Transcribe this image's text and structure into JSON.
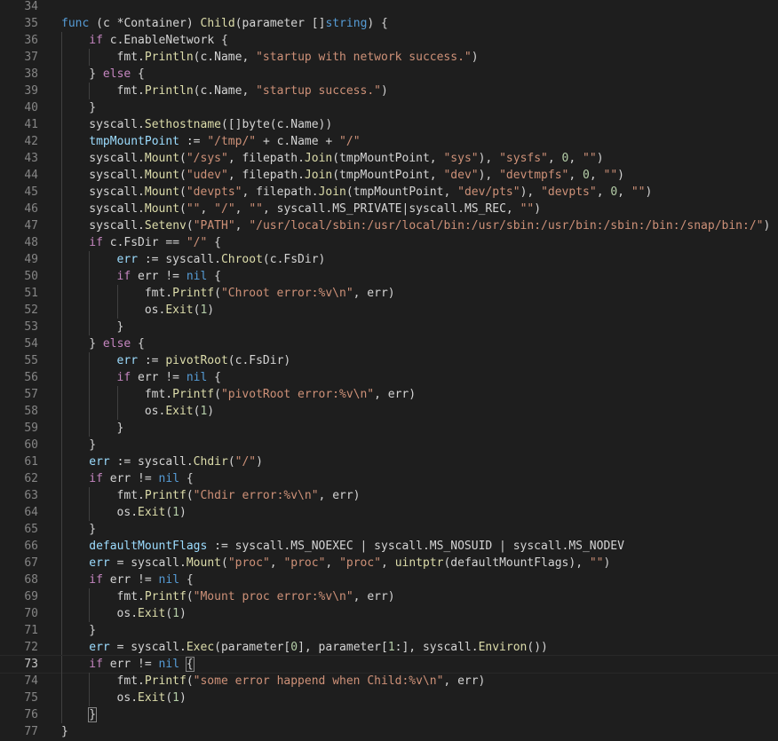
{
  "editor": {
    "colors": {
      "background": "#1e1e1e",
      "line_number": "#858585",
      "keyword": "#569cd6",
      "control": "#c586c0",
      "function": "#dcdcaa",
      "string": "#ce9178",
      "number": "#b5cea8",
      "variable": "#9cdcfe",
      "type": "#4ec9b0",
      "plain": "#d4d4d4"
    },
    "current_line": 73,
    "lines": [
      {
        "n": "34",
        "indent": 0,
        "tokens": []
      },
      {
        "n": "35",
        "indent": 0,
        "tokens": [
          [
            "kw",
            "func"
          ],
          [
            "p",
            " ("
          ],
          [
            "p",
            "c *Container"
          ],
          [
            "p",
            ") "
          ],
          [
            "fn",
            "Child"
          ],
          [
            "p",
            "(parameter []"
          ],
          [
            "kw",
            "string"
          ],
          [
            "p",
            ") {"
          ]
        ]
      },
      {
        "n": "36",
        "indent": 1,
        "tokens": [
          [
            "ctl",
            "if"
          ],
          [
            "p",
            " c.EnableNetwork {"
          ]
        ]
      },
      {
        "n": "37",
        "indent": 2,
        "tokens": [
          [
            "p",
            "fmt."
          ],
          [
            "fn",
            "Println"
          ],
          [
            "p",
            "(c.Name, "
          ],
          [
            "str",
            "\"startup with network success.\""
          ],
          [
            "p",
            ")"
          ]
        ]
      },
      {
        "n": "38",
        "indent": 1,
        "tokens": [
          [
            "p",
            "} "
          ],
          [
            "ctl",
            "else"
          ],
          [
            "p",
            " {"
          ]
        ]
      },
      {
        "n": "39",
        "indent": 2,
        "tokens": [
          [
            "p",
            "fmt."
          ],
          [
            "fn",
            "Println"
          ],
          [
            "p",
            "(c.Name, "
          ],
          [
            "str",
            "\"startup success.\""
          ],
          [
            "p",
            ")"
          ]
        ]
      },
      {
        "n": "40",
        "indent": 1,
        "tokens": [
          [
            "p",
            "}"
          ]
        ]
      },
      {
        "n": "41",
        "indent": 1,
        "tokens": [
          [
            "p",
            "syscall."
          ],
          [
            "fn",
            "Sethostname"
          ],
          [
            "p",
            "([]byte(c.Name))"
          ]
        ]
      },
      {
        "n": "42",
        "indent": 1,
        "tokens": [
          [
            "var",
            "tmpMountPoint"
          ],
          [
            "p",
            " := "
          ],
          [
            "str",
            "\"/tmp/\""
          ],
          [
            "p",
            " + c.Name + "
          ],
          [
            "str",
            "\"/\""
          ]
        ]
      },
      {
        "n": "43",
        "indent": 1,
        "tokens": [
          [
            "p",
            "syscall."
          ],
          [
            "fn",
            "Mount"
          ],
          [
            "p",
            "("
          ],
          [
            "str",
            "\"/sys\""
          ],
          [
            "p",
            ", filepath."
          ],
          [
            "fn",
            "Join"
          ],
          [
            "p",
            "(tmpMountPoint, "
          ],
          [
            "str",
            "\"sys\""
          ],
          [
            "p",
            "), "
          ],
          [
            "str",
            "\"sysfs\""
          ],
          [
            "p",
            ", "
          ],
          [
            "num",
            "0"
          ],
          [
            "p",
            ", "
          ],
          [
            "str",
            "\"\""
          ],
          [
            "p",
            ")"
          ]
        ]
      },
      {
        "n": "44",
        "indent": 1,
        "tokens": [
          [
            "p",
            "syscall."
          ],
          [
            "fn",
            "Mount"
          ],
          [
            "p",
            "("
          ],
          [
            "str",
            "\"udev\""
          ],
          [
            "p",
            ", filepath."
          ],
          [
            "fn",
            "Join"
          ],
          [
            "p",
            "(tmpMountPoint, "
          ],
          [
            "str",
            "\"dev\""
          ],
          [
            "p",
            "), "
          ],
          [
            "str",
            "\"devtmpfs\""
          ],
          [
            "p",
            ", "
          ],
          [
            "num",
            "0"
          ],
          [
            "p",
            ", "
          ],
          [
            "str",
            "\"\""
          ],
          [
            "p",
            ")"
          ]
        ]
      },
      {
        "n": "45",
        "indent": 1,
        "tokens": [
          [
            "p",
            "syscall."
          ],
          [
            "fn",
            "Mount"
          ],
          [
            "p",
            "("
          ],
          [
            "str",
            "\"devpts\""
          ],
          [
            "p",
            ", filepath."
          ],
          [
            "fn",
            "Join"
          ],
          [
            "p",
            "(tmpMountPoint, "
          ],
          [
            "str",
            "\"dev/pts\""
          ],
          [
            "p",
            "), "
          ],
          [
            "str",
            "\"devpts\""
          ],
          [
            "p",
            ", "
          ],
          [
            "num",
            "0"
          ],
          [
            "p",
            ", "
          ],
          [
            "str",
            "\"\""
          ],
          [
            "p",
            ")"
          ]
        ]
      },
      {
        "n": "46",
        "indent": 1,
        "tokens": [
          [
            "p",
            "syscall."
          ],
          [
            "fn",
            "Mount"
          ],
          [
            "p",
            "("
          ],
          [
            "str",
            "\"\""
          ],
          [
            "p",
            ", "
          ],
          [
            "str",
            "\"/\""
          ],
          [
            "p",
            ", "
          ],
          [
            "str",
            "\"\""
          ],
          [
            "p",
            ", syscall.MS_PRIVATE|syscall.MS_REC, "
          ],
          [
            "str",
            "\"\""
          ],
          [
            "p",
            ")"
          ]
        ]
      },
      {
        "n": "47",
        "indent": 1,
        "tokens": [
          [
            "p",
            "syscall."
          ],
          [
            "fn",
            "Setenv"
          ],
          [
            "p",
            "("
          ],
          [
            "str",
            "\"PATH\""
          ],
          [
            "p",
            ", "
          ],
          [
            "str",
            "\"/usr/local/sbin:/usr/local/bin:/usr/sbin:/usr/bin:/sbin:/bin:/snap/bin:/\""
          ],
          [
            "p",
            ")"
          ]
        ]
      },
      {
        "n": "48",
        "indent": 1,
        "tokens": [
          [
            "ctl",
            "if"
          ],
          [
            "p",
            " c.FsDir == "
          ],
          [
            "str",
            "\"/\""
          ],
          [
            "p",
            " {"
          ]
        ]
      },
      {
        "n": "49",
        "indent": 2,
        "tokens": [
          [
            "var",
            "err"
          ],
          [
            "p",
            " := syscall."
          ],
          [
            "fn",
            "Chroot"
          ],
          [
            "p",
            "(c.FsDir)"
          ]
        ]
      },
      {
        "n": "50",
        "indent": 2,
        "tokens": [
          [
            "ctl",
            "if"
          ],
          [
            "p",
            " err != "
          ],
          [
            "kw",
            "nil"
          ],
          [
            "p",
            " {"
          ]
        ]
      },
      {
        "n": "51",
        "indent": 3,
        "tokens": [
          [
            "p",
            "fmt."
          ],
          [
            "fn",
            "Printf"
          ],
          [
            "p",
            "("
          ],
          [
            "str",
            "\"Chroot error:%v\\n\""
          ],
          [
            "p",
            ", err)"
          ]
        ]
      },
      {
        "n": "52",
        "indent": 3,
        "tokens": [
          [
            "p",
            "os."
          ],
          [
            "fn",
            "Exit"
          ],
          [
            "p",
            "("
          ],
          [
            "num",
            "1"
          ],
          [
            "p",
            ")"
          ]
        ]
      },
      {
        "n": "53",
        "indent": 2,
        "tokens": [
          [
            "p",
            "}"
          ]
        ]
      },
      {
        "n": "54",
        "indent": 1,
        "tokens": [
          [
            "p",
            "} "
          ],
          [
            "ctl",
            "else"
          ],
          [
            "p",
            " {"
          ]
        ]
      },
      {
        "n": "55",
        "indent": 2,
        "tokens": [
          [
            "var",
            "err"
          ],
          [
            "p",
            " := "
          ],
          [
            "fn",
            "pivotRoot"
          ],
          [
            "p",
            "(c.FsDir)"
          ]
        ]
      },
      {
        "n": "56",
        "indent": 2,
        "tokens": [
          [
            "ctl",
            "if"
          ],
          [
            "p",
            " err != "
          ],
          [
            "kw",
            "nil"
          ],
          [
            "p",
            " {"
          ]
        ]
      },
      {
        "n": "57",
        "indent": 3,
        "tokens": [
          [
            "p",
            "fmt."
          ],
          [
            "fn",
            "Printf"
          ],
          [
            "p",
            "("
          ],
          [
            "str",
            "\"pivotRoot error:%v\\n\""
          ],
          [
            "p",
            ", err)"
          ]
        ]
      },
      {
        "n": "58",
        "indent": 3,
        "tokens": [
          [
            "p",
            "os."
          ],
          [
            "fn",
            "Exit"
          ],
          [
            "p",
            "("
          ],
          [
            "num",
            "1"
          ],
          [
            "p",
            ")"
          ]
        ]
      },
      {
        "n": "59",
        "indent": 2,
        "tokens": [
          [
            "p",
            "}"
          ]
        ]
      },
      {
        "n": "60",
        "indent": 1,
        "tokens": [
          [
            "p",
            "}"
          ]
        ]
      },
      {
        "n": "61",
        "indent": 1,
        "tokens": [
          [
            "var",
            "err"
          ],
          [
            "p",
            " := syscall."
          ],
          [
            "fn",
            "Chdir"
          ],
          [
            "p",
            "("
          ],
          [
            "str",
            "\"/\""
          ],
          [
            "p",
            ")"
          ]
        ]
      },
      {
        "n": "62",
        "indent": 1,
        "tokens": [
          [
            "ctl",
            "if"
          ],
          [
            "p",
            " err != "
          ],
          [
            "kw",
            "nil"
          ],
          [
            "p",
            " {"
          ]
        ]
      },
      {
        "n": "63",
        "indent": 2,
        "tokens": [
          [
            "p",
            "fmt."
          ],
          [
            "fn",
            "Printf"
          ],
          [
            "p",
            "("
          ],
          [
            "str",
            "\"Chdir error:%v\\n\""
          ],
          [
            "p",
            ", err)"
          ]
        ]
      },
      {
        "n": "64",
        "indent": 2,
        "tokens": [
          [
            "p",
            "os."
          ],
          [
            "fn",
            "Exit"
          ],
          [
            "p",
            "("
          ],
          [
            "num",
            "1"
          ],
          [
            "p",
            ")"
          ]
        ]
      },
      {
        "n": "65",
        "indent": 1,
        "tokens": [
          [
            "p",
            "}"
          ]
        ]
      },
      {
        "n": "66",
        "indent": 1,
        "tokens": [
          [
            "var",
            "defaultMountFlags"
          ],
          [
            "p",
            " := syscall.MS_NOEXEC | syscall.MS_NOSUID | syscall.MS_NODEV"
          ]
        ]
      },
      {
        "n": "67",
        "indent": 1,
        "tokens": [
          [
            "var",
            "err"
          ],
          [
            "p",
            " = syscall."
          ],
          [
            "fn",
            "Mount"
          ],
          [
            "p",
            "("
          ],
          [
            "str",
            "\"proc\""
          ],
          [
            "p",
            ", "
          ],
          [
            "str",
            "\"proc\""
          ],
          [
            "p",
            ", "
          ],
          [
            "str",
            "\"proc\""
          ],
          [
            "p",
            ", "
          ],
          [
            "fn",
            "uintptr"
          ],
          [
            "p",
            "(defaultMountFlags), "
          ],
          [
            "str",
            "\"\""
          ],
          [
            "p",
            ")"
          ]
        ]
      },
      {
        "n": "68",
        "indent": 1,
        "tokens": [
          [
            "ctl",
            "if"
          ],
          [
            "p",
            " err != "
          ],
          [
            "kw",
            "nil"
          ],
          [
            "p",
            " {"
          ]
        ]
      },
      {
        "n": "69",
        "indent": 2,
        "tokens": [
          [
            "p",
            "fmt."
          ],
          [
            "fn",
            "Printf"
          ],
          [
            "p",
            "("
          ],
          [
            "str",
            "\"Mount proc error:%v\\n\""
          ],
          [
            "p",
            ", err)"
          ]
        ]
      },
      {
        "n": "70",
        "indent": 2,
        "tokens": [
          [
            "p",
            "os."
          ],
          [
            "fn",
            "Exit"
          ],
          [
            "p",
            "("
          ],
          [
            "num",
            "1"
          ],
          [
            "p",
            ")"
          ]
        ]
      },
      {
        "n": "71",
        "indent": 1,
        "tokens": [
          [
            "p",
            "}"
          ]
        ]
      },
      {
        "n": "72",
        "indent": 1,
        "tokens": [
          [
            "var",
            "err"
          ],
          [
            "p",
            " = syscall."
          ],
          [
            "fn",
            "Exec"
          ],
          [
            "p",
            "(parameter["
          ],
          [
            "num",
            "0"
          ],
          [
            "p",
            "], parameter["
          ],
          [
            "num",
            "1"
          ],
          [
            "p",
            ":], syscall."
          ],
          [
            "fn",
            "Environ"
          ],
          [
            "p",
            "())"
          ]
        ]
      },
      {
        "n": "73",
        "indent": 1,
        "tokens": [
          [
            "ctl",
            "if"
          ],
          [
            "p",
            " err != "
          ],
          [
            "kw",
            "nil"
          ],
          [
            "p",
            " "
          ],
          [
            "br",
            "{"
          ]
        ]
      },
      {
        "n": "74",
        "indent": 2,
        "tokens": [
          [
            "p",
            "fmt."
          ],
          [
            "fn",
            "Printf"
          ],
          [
            "p",
            "("
          ],
          [
            "str",
            "\"some error happend when Child:%v\\n\""
          ],
          [
            "p",
            ", err)"
          ]
        ]
      },
      {
        "n": "75",
        "indent": 2,
        "tokens": [
          [
            "p",
            "os."
          ],
          [
            "fn",
            "Exit"
          ],
          [
            "p",
            "("
          ],
          [
            "num",
            "1"
          ],
          [
            "p",
            ")"
          ]
        ]
      },
      {
        "n": "76",
        "indent": 1,
        "tokens": [
          [
            "br",
            "}"
          ]
        ]
      },
      {
        "n": "77",
        "indent": 0,
        "tokens": [
          [
            "p",
            "}"
          ]
        ]
      }
    ]
  }
}
